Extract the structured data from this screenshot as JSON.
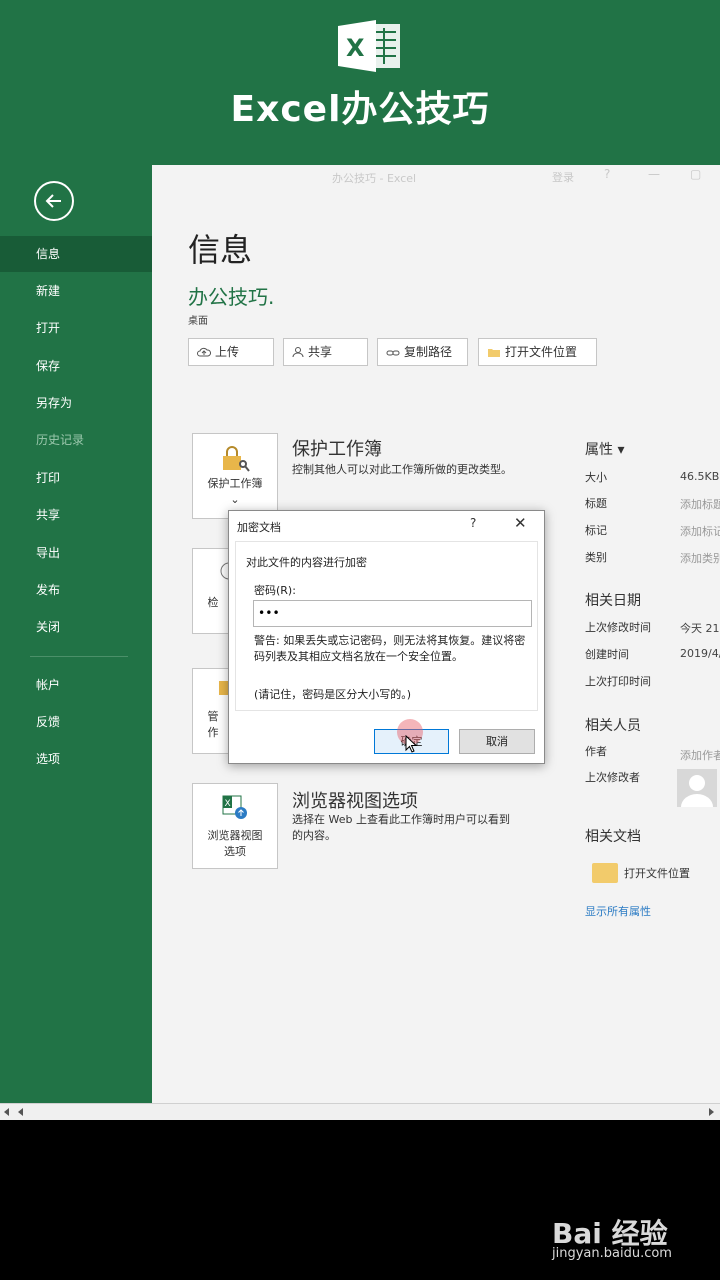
{
  "banner": {
    "logo_letter": "X",
    "title": "Excel办公技巧"
  },
  "window": {
    "title": "办公技巧 - Excel",
    "login": "登录",
    "minimize": "?",
    "restore": "▢",
    "close": "✕"
  },
  "sidebar": {
    "items": [
      {
        "label": "信息",
        "state": "active"
      },
      {
        "label": "新建"
      },
      {
        "label": "打开"
      },
      {
        "label": "保存"
      },
      {
        "label": "另存为"
      },
      {
        "label": "历史记录",
        "state": "disabled"
      },
      {
        "label": "打印"
      },
      {
        "label": "共享"
      },
      {
        "label": "导出"
      },
      {
        "label": "发布"
      },
      {
        "label": "关闭"
      },
      {
        "label": "帐户"
      },
      {
        "label": "反馈"
      },
      {
        "label": "选项"
      }
    ]
  },
  "info": {
    "page_title": "信息",
    "file_name": "办公技巧.",
    "location": "桌面",
    "actions": {
      "upload": "上传",
      "share": "共享",
      "copy_path": "复制路径",
      "open_location": "打开文件位置"
    },
    "protect": {
      "tile_label": "保护工作簿",
      "title": "保护工作簿",
      "description": "控制其他人可以对此工作簿所做的更改类型。"
    },
    "inspect_partial": "检",
    "manage_partial": "管\n作",
    "browser": {
      "tile_label": "浏览器视图\n选项",
      "title": "浏览器视图选项",
      "description": "选择在 Web 上查看此工作簿时用户可以看到的内容。"
    }
  },
  "properties": {
    "heading": "属性 ▾",
    "rows": [
      {
        "key": "大小",
        "value": "46.5KB"
      },
      {
        "key": "标题",
        "value": "添加标题"
      },
      {
        "key": "标记",
        "value": "添加标记"
      },
      {
        "key": "类别",
        "value": "添加类别"
      }
    ],
    "dates_heading": "相关日期",
    "dates": [
      {
        "key": "上次修改时间",
        "value": "今天 21:"
      },
      {
        "key": "创建时间",
        "value": "2019/4/"
      },
      {
        "key": "上次打印时间",
        "value": ""
      }
    ],
    "people_heading": "相关人员",
    "author_key": "作者",
    "author_value": "添加作者",
    "modified_by_key": "上次修改者",
    "docs_heading": "相关文档",
    "open_location": "打开文件位置",
    "show_all": "显示所有属性"
  },
  "dialog": {
    "title": "加密文档",
    "help": "?",
    "close": "✕",
    "description": "对此文件的内容进行加密",
    "password_label": "密码(R):",
    "password_value": "•••",
    "warning": "警告: 如果丢失或忘记密码，则无法将其恢复。建议将密码列表及其相应文档名放在一个安全位置。",
    "reminder": "(请记住，密码是区分大小写的。)",
    "ok": "确定",
    "cancel": "取消"
  },
  "watermark": {
    "logo": "Bai 经验",
    "url": "jingyan.baidu.com"
  }
}
